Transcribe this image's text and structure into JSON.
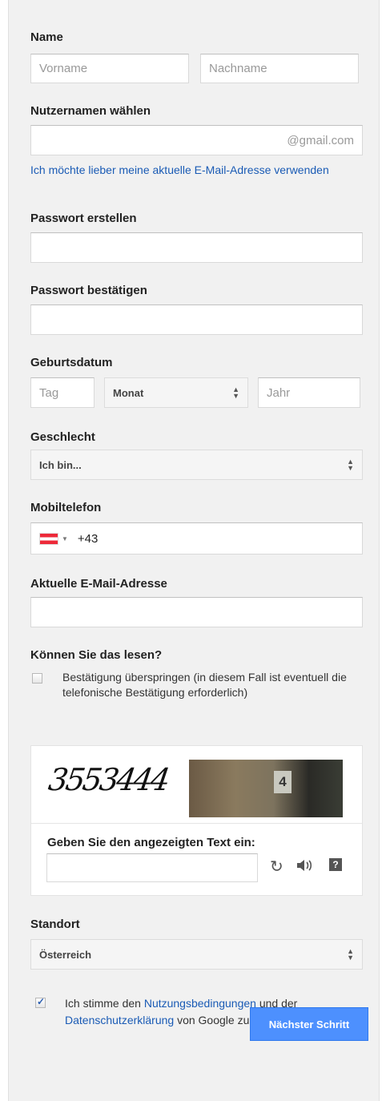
{
  "name": {
    "label": "Name",
    "first_placeholder": "Vorname",
    "last_placeholder": "Nachname"
  },
  "username": {
    "label": "Nutzernamen wählen",
    "suffix": "@gmail.com",
    "alt_link": "Ich möchte lieber meine aktuelle E-Mail-Adresse verwenden"
  },
  "password": {
    "create_label": "Passwort erstellen",
    "confirm_label": "Passwort bestätigen"
  },
  "birthdate": {
    "label": "Geburtsdatum",
    "day_placeholder": "Tag",
    "month_value": "Monat",
    "year_placeholder": "Jahr"
  },
  "gender": {
    "label": "Geschlecht",
    "value": "Ich bin..."
  },
  "mobile": {
    "label": "Mobiltelefon",
    "country_flag": "austria-flag",
    "value": "+43"
  },
  "current_email": {
    "label": "Aktuelle E-Mail-Adresse"
  },
  "captcha": {
    "question": "Können Sie das lesen?",
    "skip_text": "Bestätigung überspringen (in diesem Fall ist eventuell die telefonische Bestätigung erforderlich)",
    "skip_checked": false,
    "text_image": "3553444",
    "photo_label": "4",
    "prompt": "Geben Sie den angezeigten Text ein:",
    "icons": [
      "refresh-icon",
      "audio-icon",
      "help-icon"
    ]
  },
  "location": {
    "label": "Standort",
    "value": "Österreich"
  },
  "terms": {
    "checked": true,
    "text_before": "Ich stimme den",
    "terms_link": "Nutzungsbedingungen",
    "text_middle": "und der",
    "privacy_link": "Datenschutzerklärung",
    "text_after": "von Google zu."
  },
  "next_button": "Nächster Schritt",
  "colors": {
    "accent": "#4d90fe",
    "link": "#1a5bb5",
    "flag_red": "#ed2939"
  }
}
